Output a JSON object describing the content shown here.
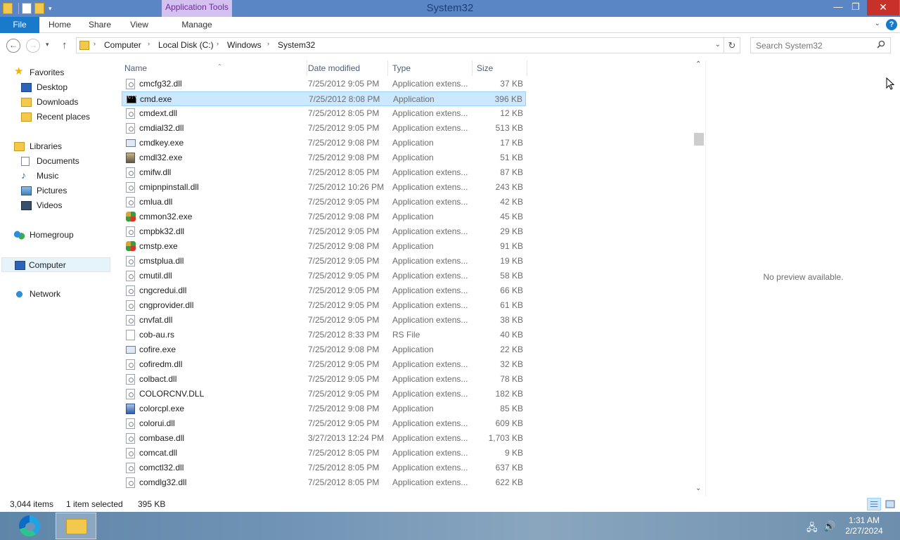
{
  "window": {
    "title": "System32",
    "contextual_tab_header": "Application Tools",
    "minimize": "—",
    "maximize": "❐",
    "close": "✕"
  },
  "ribbon": {
    "tabs": [
      "File",
      "Home",
      "Share",
      "View",
      "Manage"
    ],
    "expand": "⌄",
    "help": "?"
  },
  "nav": {
    "back": "←",
    "forward": "→",
    "recent": "▾",
    "up": "↑",
    "breadcrumb": [
      "Computer",
      "Local Disk (C:)",
      "Windows",
      "System32"
    ],
    "separator": "›",
    "address_dropdown": "⌄",
    "refresh": "↻",
    "search_placeholder": "Search System32"
  },
  "navpane": {
    "items": [
      {
        "label": "Favorites",
        "icon": "star-icon"
      },
      {
        "label": "Desktop",
        "icon": "desktop-icon"
      },
      {
        "label": "Downloads",
        "icon": "downloads-folder-icon"
      },
      {
        "label": "Recent places",
        "icon": "recent-places-icon"
      },
      {
        "label": "Libraries",
        "icon": "libraries-icon"
      },
      {
        "label": "Documents",
        "icon": "documents-icon"
      },
      {
        "label": "Music",
        "icon": "music-icon"
      },
      {
        "label": "Pictures",
        "icon": "pictures-icon"
      },
      {
        "label": "Videos",
        "icon": "videos-icon"
      },
      {
        "label": "Homegroup",
        "icon": "homegroup-icon"
      },
      {
        "label": "Computer",
        "icon": "computer-icon"
      },
      {
        "label": "Network",
        "icon": "network-icon"
      }
    ],
    "selected": "Computer"
  },
  "filelist": {
    "columns": [
      "Name",
      "Date modified",
      "Type",
      "Size"
    ],
    "sort_arrow": "⌃",
    "rows": [
      {
        "name": "cmcfg32.dll",
        "date": "7/25/2012 9:05 PM",
        "type": "Application extens...",
        "size": "37 KB",
        "icon": "dll-icon"
      },
      {
        "name": "cmd.exe",
        "date": "7/25/2012 8:08 PM",
        "type": "Application",
        "size": "396 KB",
        "icon": "command-prompt-icon",
        "selected": true
      },
      {
        "name": "cmdext.dll",
        "date": "7/25/2012 8:05 PM",
        "type": "Application extens...",
        "size": "12 KB",
        "icon": "dll-icon"
      },
      {
        "name": "cmdial32.dll",
        "date": "7/25/2012 9:05 PM",
        "type": "Application extens...",
        "size": "513 KB",
        "icon": "dll-icon"
      },
      {
        "name": "cmdkey.exe",
        "date": "7/25/2012 9:08 PM",
        "type": "Application",
        "size": "17 KB",
        "icon": "application-icon"
      },
      {
        "name": "cmdl32.exe",
        "date": "7/25/2012 9:08 PM",
        "type": "Application",
        "size": "51 KB",
        "icon": "photo-app-icon"
      },
      {
        "name": "cmifw.dll",
        "date": "7/25/2012 8:05 PM",
        "type": "Application extens...",
        "size": "87 KB",
        "icon": "dll-icon"
      },
      {
        "name": "cmipnpinstall.dll",
        "date": "7/25/2012 10:26 PM",
        "type": "Application extens...",
        "size": "243 KB",
        "icon": "dll-icon"
      },
      {
        "name": "cmlua.dll",
        "date": "7/25/2012 9:05 PM",
        "type": "Application extens...",
        "size": "42 KB",
        "icon": "dll-icon"
      },
      {
        "name": "cmmon32.exe",
        "date": "7/25/2012 9:08 PM",
        "type": "Application",
        "size": "45 KB",
        "icon": "connection-manager-icon"
      },
      {
        "name": "cmpbk32.dll",
        "date": "7/25/2012 9:05 PM",
        "type": "Application extens...",
        "size": "29 KB",
        "icon": "dll-icon"
      },
      {
        "name": "cmstp.exe",
        "date": "7/25/2012 9:08 PM",
        "type": "Application",
        "size": "91 KB",
        "icon": "connection-manager-icon"
      },
      {
        "name": "cmstplua.dll",
        "date": "7/25/2012 9:05 PM",
        "type": "Application extens...",
        "size": "19 KB",
        "icon": "dll-icon"
      },
      {
        "name": "cmutil.dll",
        "date": "7/25/2012 9:05 PM",
        "type": "Application extens...",
        "size": "58 KB",
        "icon": "dll-icon"
      },
      {
        "name": "cngcredui.dll",
        "date": "7/25/2012 9:05 PM",
        "type": "Application extens...",
        "size": "66 KB",
        "icon": "dll-icon"
      },
      {
        "name": "cngprovider.dll",
        "date": "7/25/2012 9:05 PM",
        "type": "Application extens...",
        "size": "61 KB",
        "icon": "dll-icon"
      },
      {
        "name": "cnvfat.dll",
        "date": "7/25/2012 9:05 PM",
        "type": "Application extens...",
        "size": "38 KB",
        "icon": "dll-icon"
      },
      {
        "name": "cob-au.rs",
        "date": "7/25/2012 8:33 PM",
        "type": "RS File",
        "size": "40 KB",
        "icon": "file-icon"
      },
      {
        "name": "cofire.exe",
        "date": "7/25/2012 9:08 PM",
        "type": "Application",
        "size": "22 KB",
        "icon": "application-icon"
      },
      {
        "name": "cofiredm.dll",
        "date": "7/25/2012 9:05 PM",
        "type": "Application extens...",
        "size": "32 KB",
        "icon": "dll-icon"
      },
      {
        "name": "colbact.dll",
        "date": "7/25/2012 9:05 PM",
        "type": "Application extens...",
        "size": "78 KB",
        "icon": "dll-icon"
      },
      {
        "name": "COLORCNV.DLL",
        "date": "7/25/2012 9:05 PM",
        "type": "Application extens...",
        "size": "182 KB",
        "icon": "dll-icon"
      },
      {
        "name": "colorcpl.exe",
        "date": "7/25/2012 9:08 PM",
        "type": "Application",
        "size": "85 KB",
        "icon": "color-management-icon"
      },
      {
        "name": "colorui.dll",
        "date": "7/25/2012 9:05 PM",
        "type": "Application extens...",
        "size": "609 KB",
        "icon": "dll-icon"
      },
      {
        "name": "combase.dll",
        "date": "3/27/2013 12:24 PM",
        "type": "Application extens...",
        "size": "1,703 KB",
        "icon": "dll-icon"
      },
      {
        "name": "comcat.dll",
        "date": "7/25/2012 8:05 PM",
        "type": "Application extens...",
        "size": "9 KB",
        "icon": "dll-icon"
      },
      {
        "name": "comctl32.dll",
        "date": "7/25/2012 8:05 PM",
        "type": "Application extens...",
        "size": "637 KB",
        "icon": "dll-icon"
      },
      {
        "name": "comdlg32.dll",
        "date": "7/25/2012 8:05 PM",
        "type": "Application extens...",
        "size": "622 KB",
        "icon": "dll-icon"
      }
    ]
  },
  "scrollbar": {
    "up": "⌃",
    "down": "⌄"
  },
  "preview": {
    "text": "No preview available."
  },
  "status": {
    "item_count": "3,044 items",
    "selection": "1 item selected",
    "selection_size": "395 KB"
  },
  "taskbar": {
    "time": "1:31 AM",
    "date": "2/27/2024"
  }
}
